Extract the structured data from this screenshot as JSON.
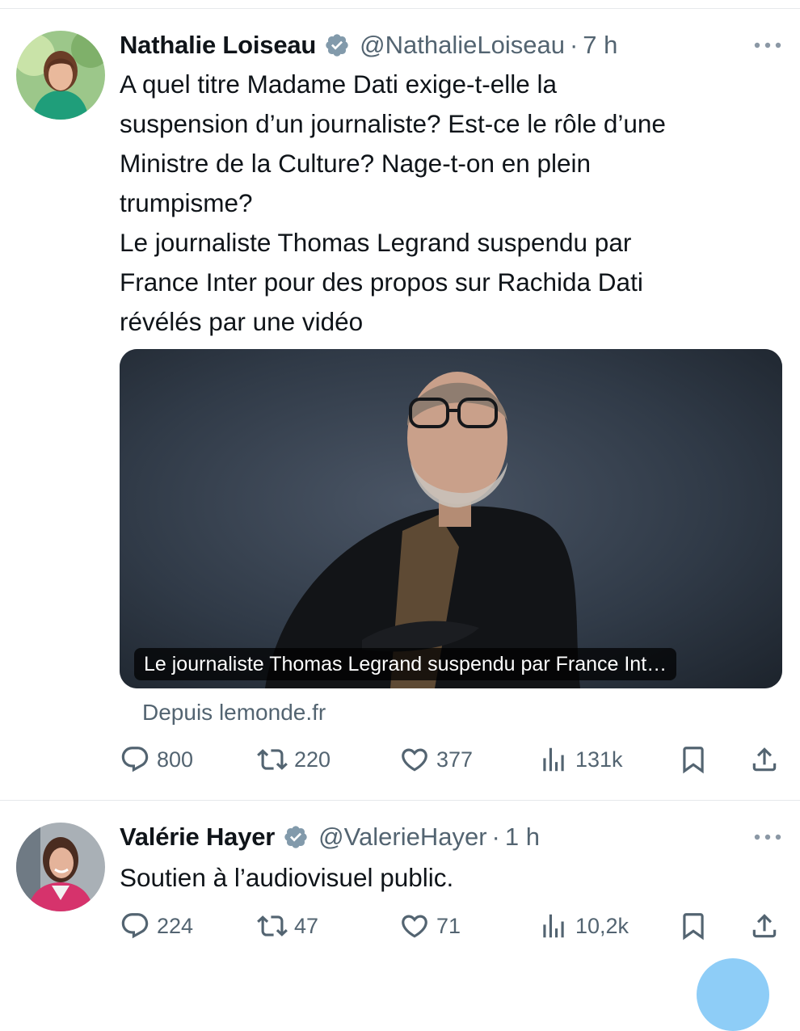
{
  "tweets": [
    {
      "author": "Nathalie Loiseau",
      "handle": "@NathalieLoiseau",
      "separator": "·",
      "time": "7 h",
      "text": "A quel titre Madame Dati exige-t-elle la\nsuspension d’un journaliste? Est-ce le rôle d’une\nMinistre de la Culture? Nage-t-on en plein\ntrumpisme?\nLe journaliste Thomas Legrand suspendu par\nFrance Inter pour des propos sur Rachida Dati\nrévélés par une vidéo",
      "card": {
        "caption": "Le journaliste Thomas Legrand suspendu par France Int…",
        "source": "Depuis lemonde.fr"
      },
      "stats": {
        "replies": "800",
        "reposts": "220",
        "likes": "377",
        "views": "131k"
      }
    },
    {
      "author": "Valérie Hayer",
      "handle": "@ValerieHayer",
      "separator": "·",
      "time": "1 h",
      "text": "Soutien à l’audiovisuel public.",
      "stats": {
        "replies": "224",
        "reposts": "47",
        "likes": "71",
        "views": "10,2k"
      }
    }
  ],
  "icons": {
    "verified": "verified-badge-icon",
    "more": "more-horizontal-icon",
    "reply": "reply-icon",
    "repost": "repost-icon",
    "like": "heart-icon",
    "views": "views-chart-icon",
    "bookmark": "bookmark-icon",
    "share": "share-icon"
  },
  "colors": {
    "text": "#0f1419",
    "secondary": "#536471",
    "verified_badge": "#829aab",
    "divider": "#e6e9eb",
    "fab": "#8ecdf7"
  }
}
